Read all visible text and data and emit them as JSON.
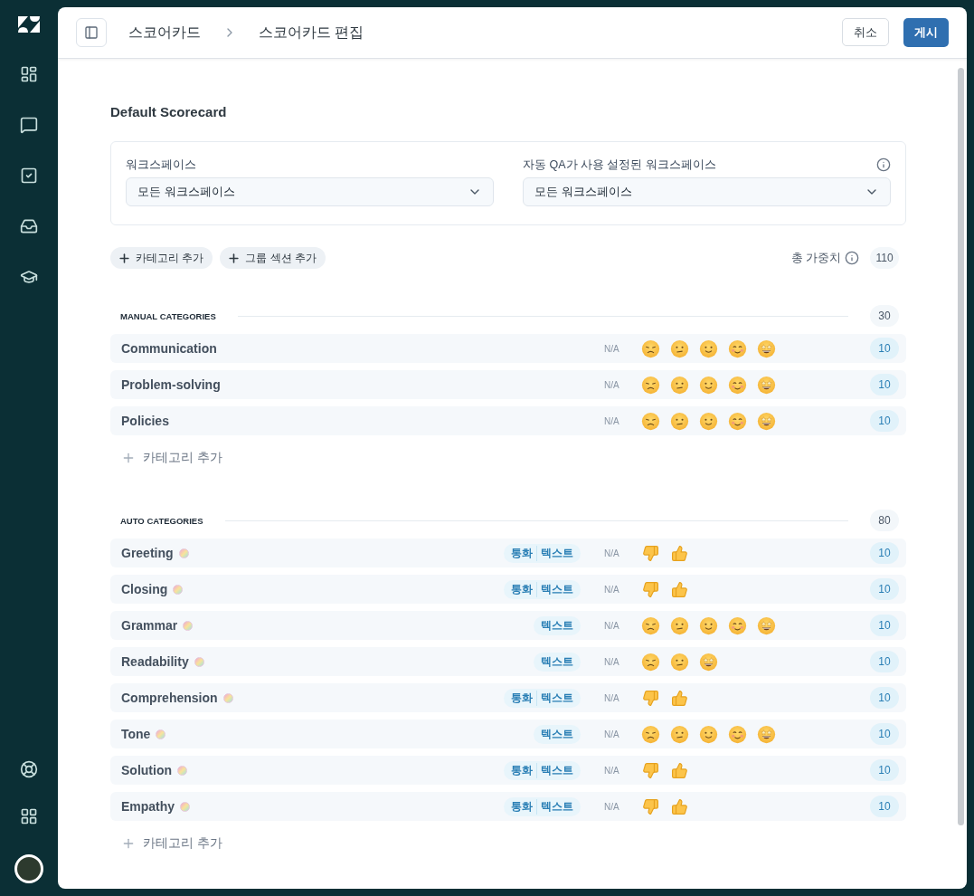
{
  "breadcrumb": [
    "스코어카드",
    "스코어카드 편집"
  ],
  "buttons": {
    "cancel": "취소",
    "publish": "게시"
  },
  "title": "Default Scorecard",
  "workspace_fields": [
    {
      "label": "워크스페이스",
      "value": "모든 워크스페이스"
    },
    {
      "label": "자동 QA가 사용 설정된 워크스페이스",
      "value": "모든 워크스페이스",
      "info": true
    }
  ],
  "actions": [
    "카테고리 추가",
    "그룹 섹션 추가"
  ],
  "total_weight": {
    "label": "총 가중치",
    "value": "110"
  },
  "sections": [
    {
      "title": "MANUAL CATEGORIES",
      "weight": "30",
      "add_label": "카테고리 추가",
      "categories": [
        {
          "name": "Communication",
          "auto": false,
          "kind": "five",
          "na": "N/A",
          "weight": "10"
        },
        {
          "name": "Problem-solving",
          "auto": false,
          "kind": "five",
          "na": "N/A",
          "weight": "10"
        },
        {
          "name": "Policies",
          "auto": false,
          "kind": "five",
          "na": "N/A",
          "weight": "10"
        }
      ]
    },
    {
      "title": "AUTO CATEGORIES",
      "weight": "80",
      "add_label": "카테고리 추가",
      "categories": [
        {
          "name": "Greeting",
          "auto": true,
          "channels": [
            "통화",
            "텍스트"
          ],
          "kind": "thumbs",
          "na": "N/A",
          "weight": "10"
        },
        {
          "name": "Closing",
          "auto": true,
          "channels": [
            "통화",
            "텍스트"
          ],
          "kind": "thumbs",
          "na": "N/A",
          "weight": "10"
        },
        {
          "name": "Grammar",
          "auto": true,
          "channels": [
            "텍스트"
          ],
          "kind": "five",
          "na": "N/A",
          "weight": "10"
        },
        {
          "name": "Readability",
          "auto": true,
          "channels": [
            "텍스트"
          ],
          "kind": "three",
          "na": "N/A",
          "weight": "10"
        },
        {
          "name": "Comprehension",
          "auto": true,
          "channels": [
            "통화",
            "텍스트"
          ],
          "kind": "thumbs",
          "na": "N/A",
          "weight": "10"
        },
        {
          "name": "Tone",
          "auto": true,
          "channels": [
            "텍스트"
          ],
          "kind": "five",
          "na": "N/A",
          "weight": "10"
        },
        {
          "name": "Solution",
          "auto": true,
          "channels": [
            "통화",
            "텍스트"
          ],
          "kind": "thumbs",
          "na": "N/A",
          "weight": "10"
        },
        {
          "name": "Empathy",
          "auto": true,
          "channels": [
            "통화",
            "텍스트"
          ],
          "kind": "thumbs",
          "na": "N/A",
          "weight": "10"
        }
      ]
    }
  ]
}
